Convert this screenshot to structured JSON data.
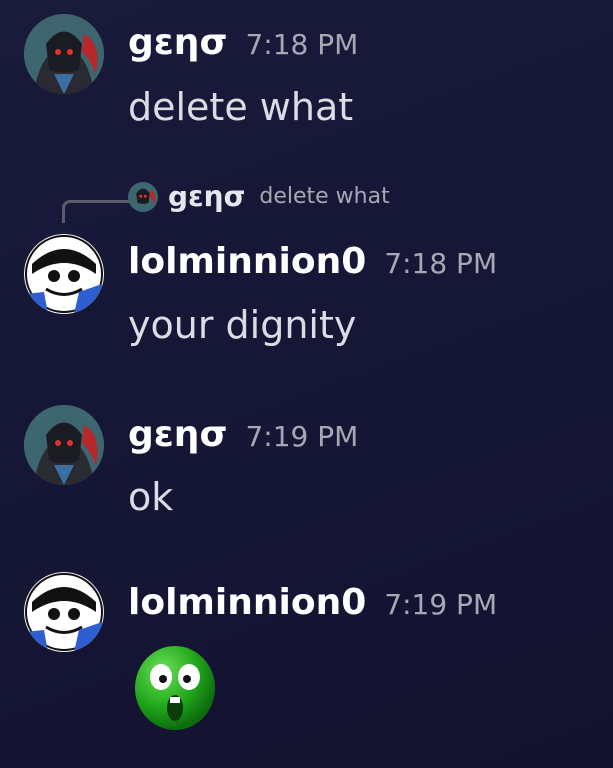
{
  "messages": [
    {
      "username": "gεησ",
      "timestamp": "7:18 PM",
      "text": "delete what"
    },
    {
      "username": "lolminnion0",
      "timestamp": "7:18 PM",
      "text": "your dignity",
      "reply": {
        "username": "gεησ",
        "text": "delete what"
      }
    },
    {
      "username": "gεησ",
      "timestamp": "7:19 PM",
      "text": "ok"
    },
    {
      "username": "lolminnion0",
      "timestamp": "7:19 PM",
      "emoji": "green-shocked-face-emoji"
    }
  ],
  "colors": {
    "username": "#ffffff",
    "timestamp": "#a7a8b4",
    "text": "#dcdde4",
    "background": "#171734"
  }
}
